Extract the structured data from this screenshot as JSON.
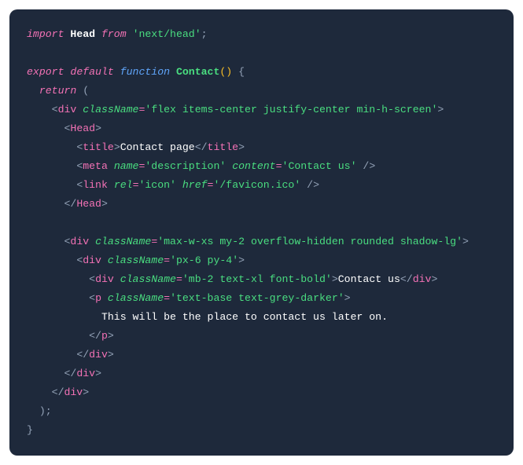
{
  "code": {
    "l1_import": "import",
    "l1_head": "Head",
    "l1_from": "from",
    "l1_mod": "'next/head'",
    "l1_semi": ";",
    "l3_export": "export",
    "l3_default": "default",
    "l3_function": "function",
    "l3_name": "Contact",
    "l3_paren": "()",
    "l3_brace": " {",
    "l4_return": "return",
    "l4_open": " (",
    "l5_open": "<",
    "l5_tag": "div",
    "l5_attr": "className",
    "l5_eq": "=",
    "l5_val": "'flex items-center justify-center min-h-screen'",
    "l5_close": ">",
    "l6_open": "<",
    "l6_tag": "Head",
    "l6_close": ">",
    "l7_open": "<",
    "l7_tag": "title",
    "l7_close": ">",
    "l7_text": "Contact page",
    "l7_copen": "</",
    "l7_ctag": "title",
    "l7_cclose": ">",
    "l8_open": "<",
    "l8_tag": "meta",
    "l8_a1": "name",
    "l8_eq1": "=",
    "l8_v1": "'description'",
    "l8_a2": "content",
    "l8_eq2": "=",
    "l8_v2": "'Contact us'",
    "l8_close": " />",
    "l9_open": "<",
    "l9_tag": "link",
    "l9_a1": "rel",
    "l9_eq1": "=",
    "l9_v1": "'icon'",
    "l9_a2": "href",
    "l9_eq2": "=",
    "l9_v2": "'/favicon.ico'",
    "l9_close": " />",
    "l10_open": "</",
    "l10_tag": "Head",
    "l10_close": ">",
    "l12_open": "<",
    "l12_tag": "div",
    "l12_attr": "className",
    "l12_eq": "=",
    "l12_val": "'max-w-xs my-2 overflow-hidden rounded shadow-lg'",
    "l12_close": ">",
    "l13_open": "<",
    "l13_tag": "div",
    "l13_attr": "className",
    "l13_eq": "=",
    "l13_val": "'px-6 py-4'",
    "l13_close": ">",
    "l14_open": "<",
    "l14_tag": "div",
    "l14_attr": "className",
    "l14_eq": "=",
    "l14_val": "'mb-2 text-xl font-bold'",
    "l14_close": ">",
    "l14_text": "Contact us",
    "l14_copen": "</",
    "l14_ctag": "div",
    "l14_cclose": ">",
    "l15_open": "<",
    "l15_tag": "p",
    "l15_attr": "className",
    "l15_eq": "=",
    "l15_val": "'text-base text-grey-darker'",
    "l15_close": ">",
    "l16_text": "This will be the place to contact us later on.",
    "l17_open": "</",
    "l17_tag": "p",
    "l17_close": ">",
    "l18_open": "</",
    "l18_tag": "div",
    "l18_close": ">",
    "l19_open": "</",
    "l19_tag": "div",
    "l19_close": ">",
    "l20_open": "</",
    "l20_tag": "div",
    "l20_close": ">",
    "l21_close": ");",
    "l22_close": "}"
  }
}
